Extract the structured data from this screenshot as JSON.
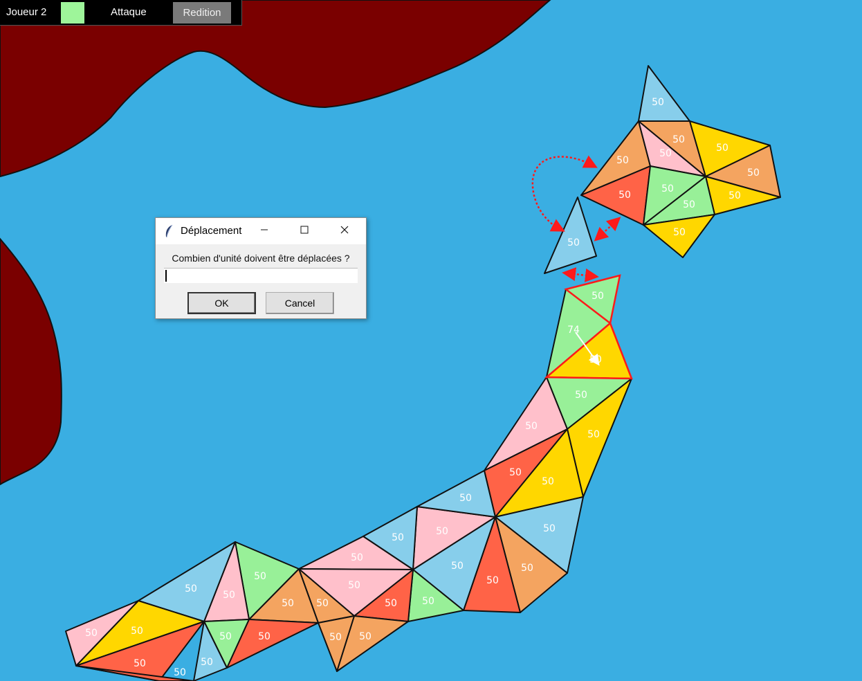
{
  "topbar": {
    "player_label": "Joueur 2",
    "player_color": "#9ef59a",
    "attack_label": "Attaque",
    "surrender_label": "Redition"
  },
  "dialog": {
    "title": "Déplacement",
    "minimize_icon": "minimize-icon",
    "maximize_icon": "maximize-icon",
    "close_icon": "close-icon",
    "prompt": "Combien d'unité doivent être déplacées ?",
    "input_value": "",
    "ok_label": "OK",
    "cancel_label": "Cancel"
  },
  "map": {
    "sea_color": "#3aaee2",
    "land_color": "#7a0000",
    "selection_color": "#ff1a1a",
    "move_source_units": "74",
    "territory_units": [
      "50",
      "50",
      "50",
      "50",
      "50",
      "50",
      "50",
      "50",
      "50",
      "50",
      "50",
      "50",
      "50",
      "50",
      "50",
      "50",
      "50",
      "50",
      "50",
      "50",
      "50",
      "50",
      "50",
      "50",
      "50",
      "50",
      "50",
      "50",
      "50",
      "50",
      "50",
      "50",
      "50",
      "50",
      "50",
      "50",
      "50",
      "50",
      "50",
      "50",
      "50",
      "50",
      "50",
      "50"
    ]
  }
}
